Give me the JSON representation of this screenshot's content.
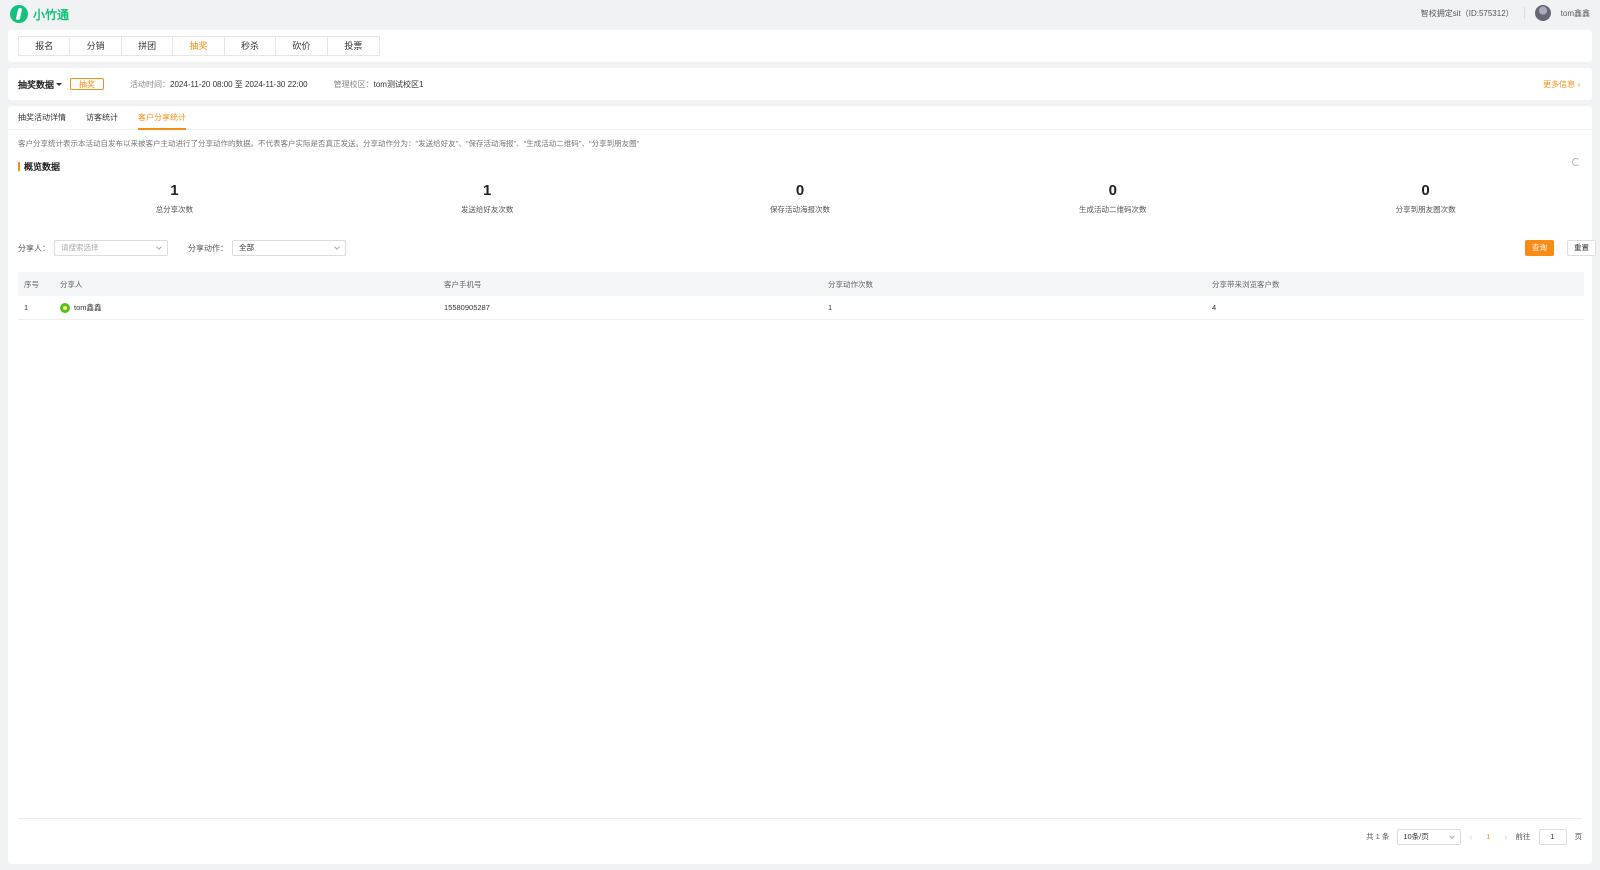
{
  "app": {
    "logo_text": "小竹通"
  },
  "header": {
    "school": "智校拥定sit（ID:575312）",
    "user": "tom鑫鑫"
  },
  "nav": {
    "tabs": [
      "报名",
      "分销",
      "拼团",
      "抽奖",
      "秒杀",
      "砍价",
      "投票"
    ],
    "active": "抽奖"
  },
  "info": {
    "title": "抽奖数据",
    "badge": "抽奖",
    "time_label": "活动时间：",
    "time_value": "2024-11-20 08:00 至 2024-11-30 22:00",
    "campus_label": "管理校区：",
    "campus_value": "tom测试校区1",
    "more": "更多信息"
  },
  "sub_tabs": {
    "items": [
      "抽奖活动详情",
      "访客统计",
      "客户分享统计"
    ],
    "active": "客户分享统计"
  },
  "description": "客户分享统计表示本活动自发布以来被客户主动进行了分享动作的数据。不代表客户实际是否真正发送。分享动作分为：\"发送给好友\"、\"保存活动海报\"、\"生成活动二维码\"、\"分享到朋友圈\"",
  "overview": {
    "title": "概览数据",
    "stats": [
      {
        "value": "1",
        "label": "总分享次数"
      },
      {
        "value": "1",
        "label": "发送给好友次数"
      },
      {
        "value": "0",
        "label": "保存活动海报次数"
      },
      {
        "value": "0",
        "label": "生成活动二维码次数"
      },
      {
        "value": "0",
        "label": "分享到朋友圈次数"
      }
    ]
  },
  "filters": {
    "sharer_label": "分享人：",
    "sharer_placeholder": "请搜索选择",
    "action_label": "分享动作：",
    "action_value": "全部",
    "query": "查询",
    "reset": "重置"
  },
  "table": {
    "headers": [
      "序号",
      "分享人",
      "客户手机号",
      "分享动作次数",
      "分享带来浏览客户数"
    ],
    "rows": [
      {
        "index": "1",
        "sharer": "tom鑫鑫",
        "phone": "15580905287",
        "actions": "1",
        "visitors": "4"
      }
    ]
  },
  "pagination": {
    "total": "共 1 条",
    "page_size": "10条/页",
    "current": "1",
    "goto_label": "前往",
    "goto_value": "1",
    "page_suffix": "页"
  },
  "colors": {
    "accent": "#fa8c16",
    "brand": "#13c27a"
  }
}
